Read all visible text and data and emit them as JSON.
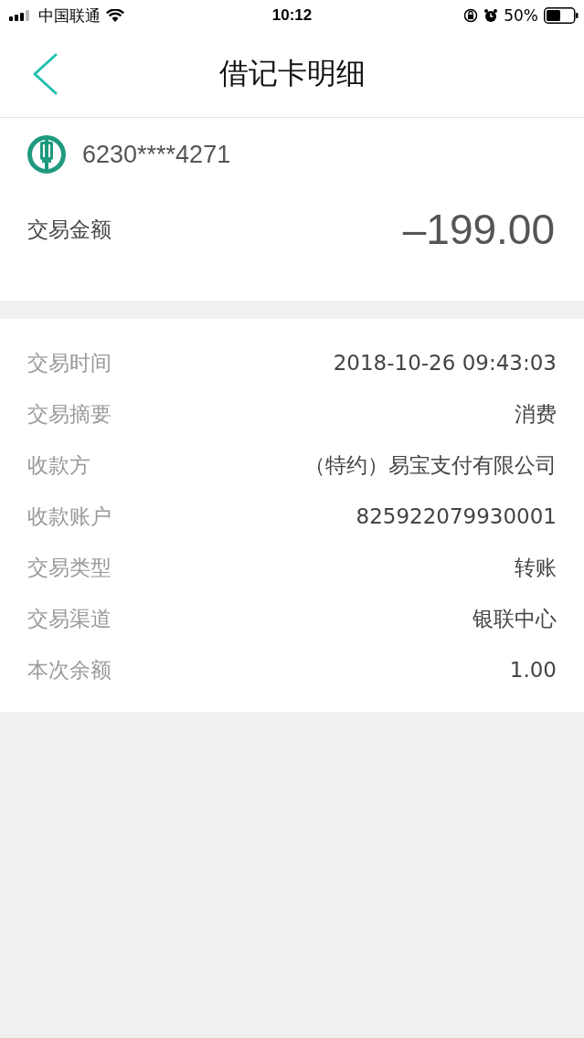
{
  "status_bar": {
    "carrier": "中国联通",
    "time": "10:12",
    "battery": "50%"
  },
  "nav": {
    "title": "借记卡明细"
  },
  "card": {
    "number": "6230****4271"
  },
  "amount": {
    "label": "交易金额",
    "value": "–199.00"
  },
  "details": [
    {
      "label": "交易时间",
      "value": "2018-10-26 09:43:03"
    },
    {
      "label": "交易摘要",
      "value": "消费"
    },
    {
      "label": "收款方",
      "value": "（特约）易宝支付有限公司"
    },
    {
      "label": "收款账户",
      "value": "825922079930001"
    },
    {
      "label": "交易类型",
      "value": "转账"
    },
    {
      "label": "交易渠道",
      "value": "银联中心"
    },
    {
      "label": "本次余额",
      "value": "1.00"
    }
  ]
}
